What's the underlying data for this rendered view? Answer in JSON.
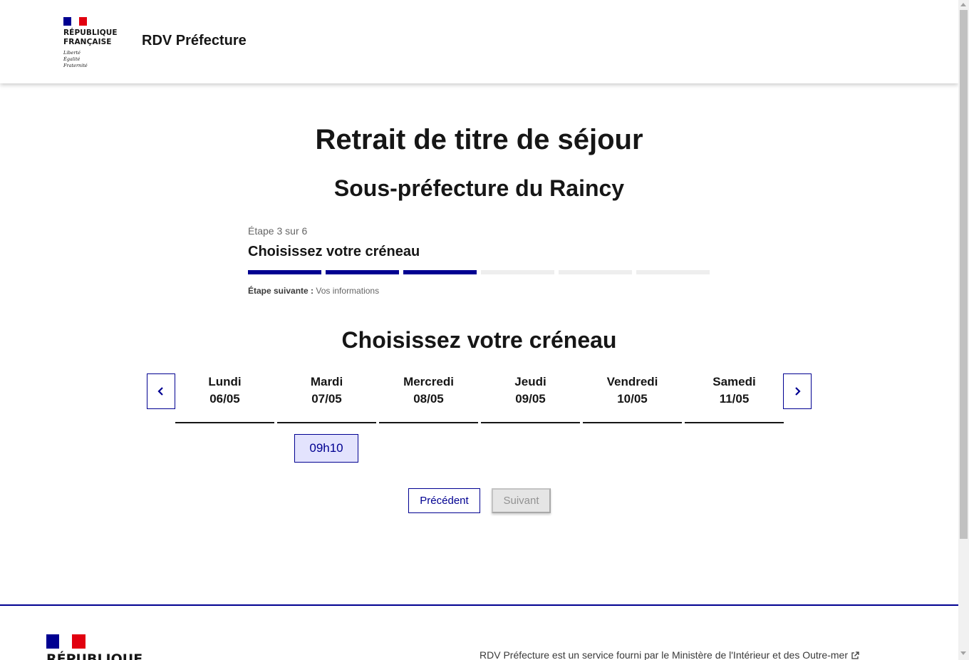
{
  "header": {
    "logo_name": "RÉPUBLIQUE\nFRANÇAISE",
    "logo_motto": "Liberté\nÉgalité\nFraternité",
    "service_title": "RDV Préfecture"
  },
  "main": {
    "title": "Retrait de titre de séjour",
    "subtitle": "Sous-préfecture du Raincy",
    "stepper": {
      "state": "Étape 3 sur 6",
      "title": "Choisissez votre créneau",
      "steps_total": 6,
      "steps_done": 3,
      "next_label": "Étape suivante :",
      "next_value": " Vos informations"
    },
    "section_title": "Choisissez votre créneau",
    "days": [
      {
        "name": "Lundi",
        "date": "06/05"
      },
      {
        "name": "Mardi",
        "date": "07/05"
      },
      {
        "name": "Mercredi",
        "date": "08/05"
      },
      {
        "name": "Jeudi",
        "date": "09/05"
      },
      {
        "name": "Vendredi",
        "date": "10/05"
      },
      {
        "name": "Samedi",
        "date": "11/05"
      }
    ],
    "slots": [
      {
        "day": "Mardi 07/05",
        "time": "09h10"
      }
    ],
    "buttons": {
      "previous": "Précédent",
      "next": "Suivant"
    }
  },
  "footer": {
    "logo_name": "RÉPUBLIQUE",
    "text": "RDV Préfecture est un service fourni par le Ministère de l'Intérieur et des Outre-mer"
  },
  "colors": {
    "primary": "#000091",
    "slot_bg": "#e3e3fd",
    "flag_red": "#e1000f",
    "disabled_bg": "#e5e5e5",
    "disabled_text": "#929292"
  },
  "icons": {
    "prev_week": "chevron-left-icon",
    "next_week": "chevron-right-icon",
    "external": "external-link-icon"
  }
}
